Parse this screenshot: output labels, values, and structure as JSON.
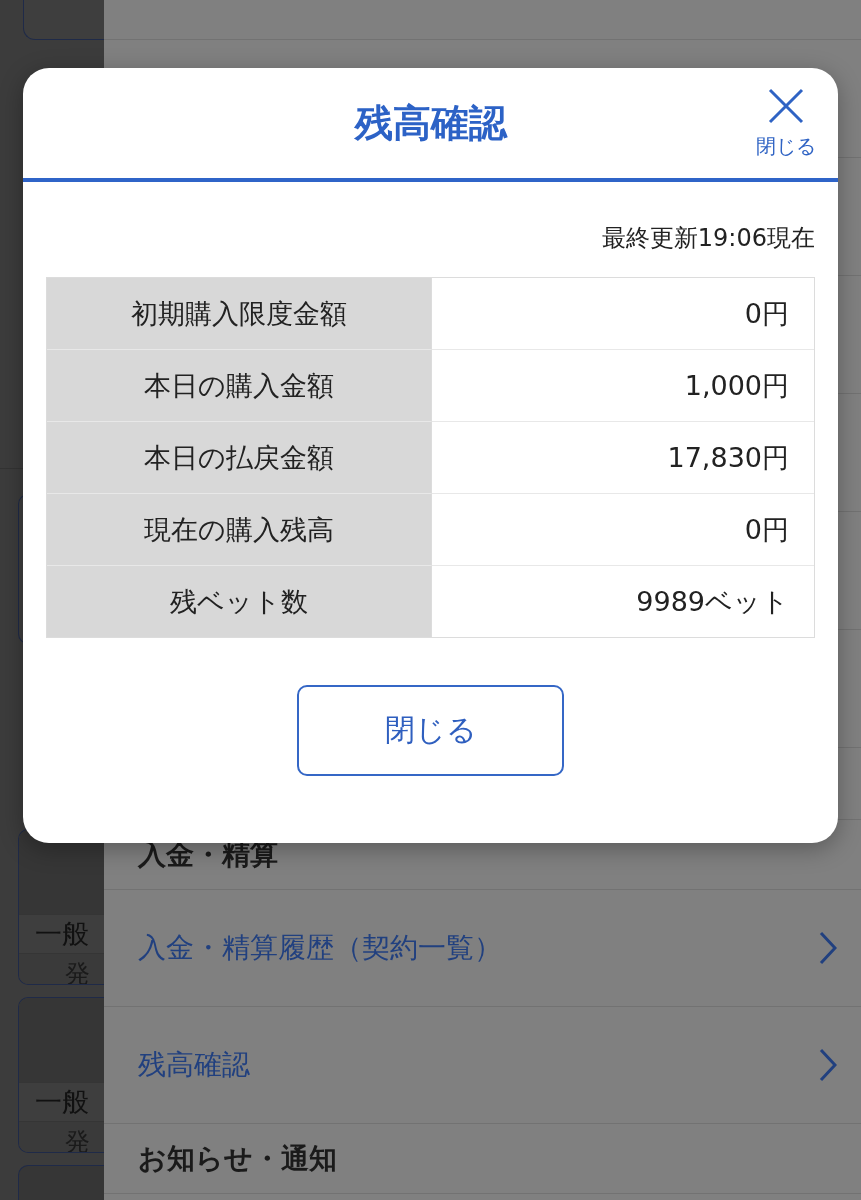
{
  "side_cards": [
    {
      "label": "一般",
      "sublabel": "発"
    },
    {
      "label": "一般",
      "sublabel": "発"
    }
  ],
  "drawer": {
    "items": [
      {
        "kind": "header",
        "label": "入金・精算"
      },
      {
        "kind": "link",
        "label": "入金・精算履歴（契約一覧）"
      },
      {
        "kind": "link",
        "label": "残高確認"
      },
      {
        "kind": "header",
        "label": "お知らせ・通知"
      }
    ]
  },
  "dialog": {
    "title": "残高確認",
    "close_label": "閉じる",
    "updated": "最終更新19:06現在",
    "rows": [
      {
        "label": "初期購入限度金額",
        "value": "0円"
      },
      {
        "label": "本日の購入金額",
        "value": "1,000円"
      },
      {
        "label": "本日の払戻金額",
        "value": "17,830円"
      },
      {
        "label": "現在の購入残高",
        "value": "0円"
      },
      {
        "label": "残ベット数",
        "value": "9989ベット"
      }
    ],
    "button": "閉じる"
  }
}
